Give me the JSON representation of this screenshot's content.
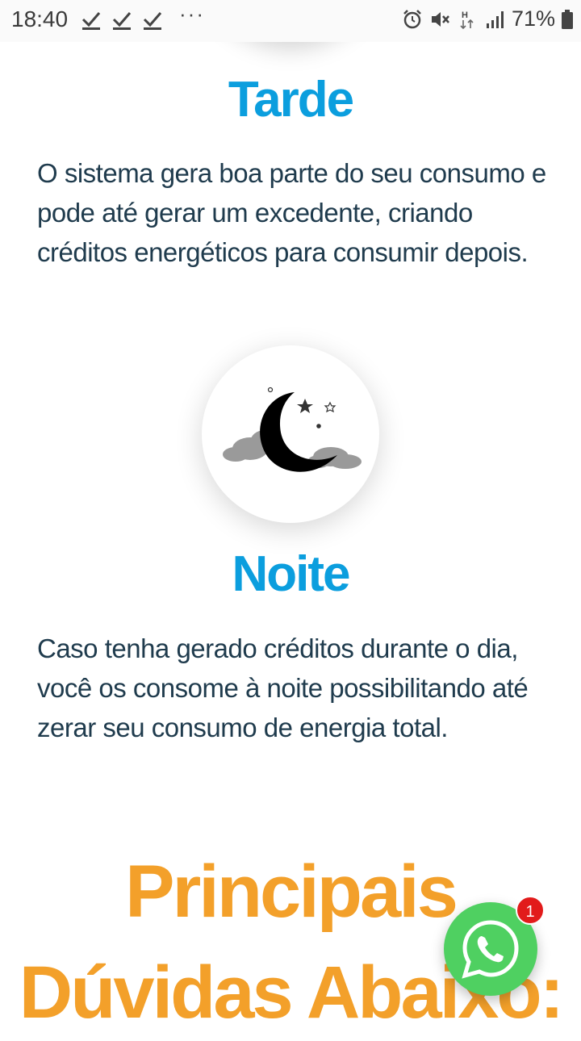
{
  "status_bar": {
    "time": "18:40",
    "more_indicator": "···",
    "battery_text": "71%",
    "icons": [
      "check-icon",
      "check-icon",
      "check-icon",
      "alarm-icon",
      "mute-icon",
      "network-h-icon",
      "signal-icon",
      "battery-icon"
    ]
  },
  "afternoon": {
    "title": "Tarde",
    "text": "O sistema gera boa parte do seu consumo e pode até gerar um excedente, criando créditos energéticos para consumir depois."
  },
  "night": {
    "icon": "moon-clouds-icon",
    "title": "Noite",
    "text": "Caso tenha gerado créditos durante o dia, você os consome à noite possibilitando até zerar seu consumo de energia total."
  },
  "faq": {
    "heading_line1": "Principais",
    "heading_line2": "Dúvidas Abaixo:"
  },
  "whatsapp": {
    "icon": "whatsapp-icon",
    "badge_count": "1"
  },
  "colors": {
    "heading_blue": "#0b9ede",
    "heading_orange": "#f3a02a",
    "body_text": "#1f3b4d",
    "whatsapp_green": "#4fd061",
    "badge_red": "#e21b1b"
  }
}
